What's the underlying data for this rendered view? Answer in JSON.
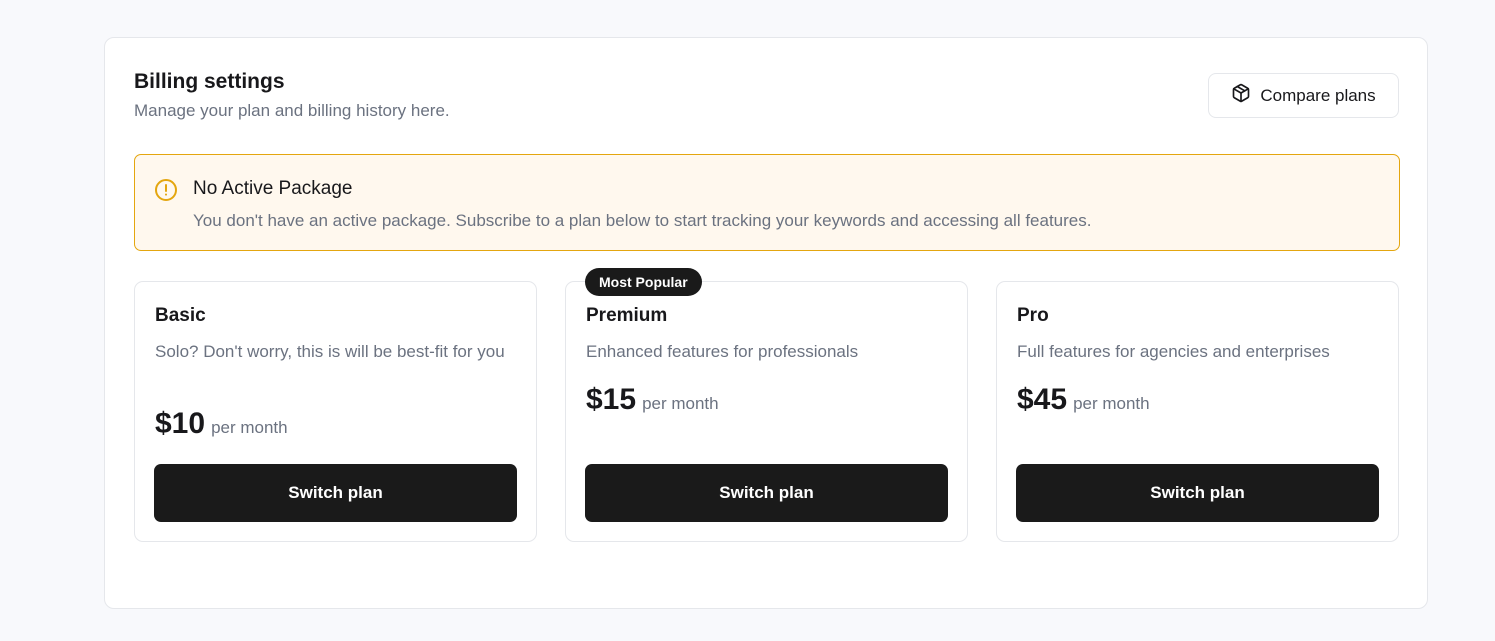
{
  "header": {
    "title": "Billing settings",
    "subtitle": "Manage your plan and billing history here.",
    "compare_label": "Compare plans",
    "compare_icon": "package-icon"
  },
  "alert": {
    "icon": "alert-circle-icon",
    "title": "No Active Package",
    "text": "You don't have an active package. Subscribe to a plan below to start tracking your keywords and accessing all features.",
    "border_color": "#e4a60f",
    "background": "#fff8ee"
  },
  "plans": [
    {
      "name": "Basic",
      "description": "Solo? Don't worry, this is will be best-fit for you",
      "price": "$10",
      "period": "per month",
      "button_label": "Switch plan"
    },
    {
      "name": "Premium",
      "badge": "Most Popular",
      "description": "Enhanced features for professionals",
      "price": "$15",
      "period": "per month",
      "button_label": "Switch plan"
    },
    {
      "name": "Pro",
      "description": "Full features for agencies and enterprises",
      "price": "$45",
      "period": "per month",
      "button_label": "Switch plan"
    }
  ],
  "colors": {
    "button_bg": "#1a1a1a",
    "muted_text": "#6b7280",
    "accent_warning": "#e4a60f"
  }
}
